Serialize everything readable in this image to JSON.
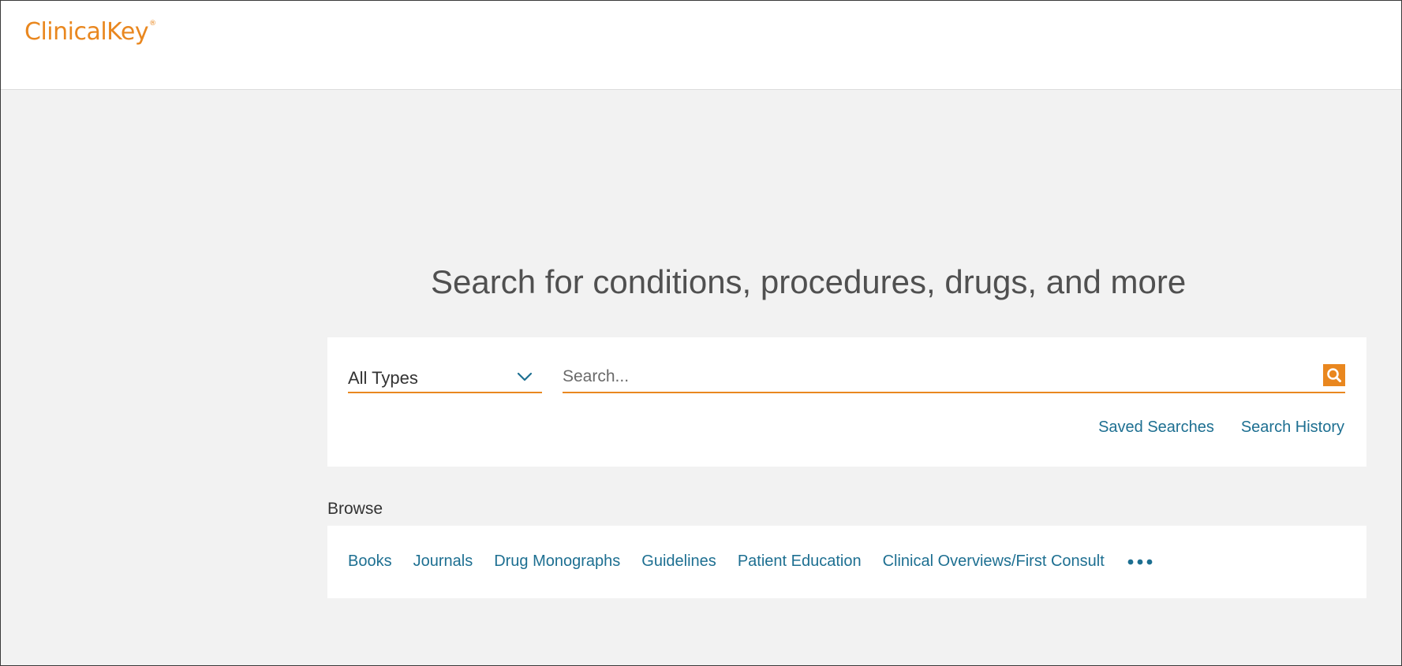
{
  "header": {
    "logo_text": "ClinicalKey",
    "logo_mark": "®"
  },
  "main": {
    "headline": "Search for conditions, procedures, drugs, and more"
  },
  "search": {
    "type_selected": "All Types",
    "placeholder": "Search...",
    "value": "",
    "links": {
      "saved_searches": "Saved Searches",
      "search_history": "Search History"
    }
  },
  "browse": {
    "label": "Browse",
    "items": [
      {
        "label": "Books"
      },
      {
        "label": "Journals"
      },
      {
        "label": "Drug Monographs"
      },
      {
        "label": "Guidelines"
      },
      {
        "label": "Patient Education"
      },
      {
        "label": "Clinical Overviews/First Consult"
      }
    ],
    "more_icon": "more-horizontal-icon"
  },
  "colors": {
    "brand_orange": "#e9871f",
    "link_blue": "#1d6f91",
    "page_background": "#f2f2f2"
  },
  "icons": {
    "dropdown": "chevron-down-icon",
    "search": "search-icon"
  }
}
